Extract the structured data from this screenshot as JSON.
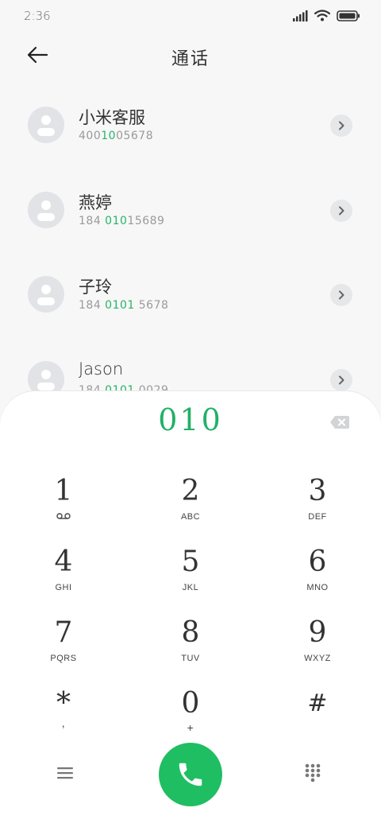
{
  "status_bar": {
    "time": "2:36"
  },
  "header": {
    "title": "通话"
  },
  "contacts": [
    {
      "name": "小米客服",
      "number_pre": "400",
      "number_match": "10",
      "number_post": "05678"
    },
    {
      "name": "燕婷",
      "number_pre": "184 ",
      "number_match": "010",
      "number_post": "15689"
    },
    {
      "name": "子玲",
      "number_pre": "184 ",
      "number_match": "0101",
      "number_post": " 5678"
    },
    {
      "name": "Jason",
      "number_pre": "184 ",
      "number_match": "0101",
      "number_post": " 0029"
    }
  ],
  "dialpad": {
    "dialed_number": "010",
    "keys": [
      {
        "digit": "1",
        "letters": "voicemail"
      },
      {
        "digit": "2",
        "letters": "ABC"
      },
      {
        "digit": "3",
        "letters": "DEF"
      },
      {
        "digit": "4",
        "letters": "GHI"
      },
      {
        "digit": "5",
        "letters": "JKL"
      },
      {
        "digit": "6",
        "letters": "MNO"
      },
      {
        "digit": "7",
        "letters": "PQRS"
      },
      {
        "digit": "8",
        "letters": "TUV"
      },
      {
        "digit": "9",
        "letters": "WXYZ"
      },
      {
        "digit": "*",
        "letters": ","
      },
      {
        "digit": "0",
        "letters": "+"
      },
      {
        "digit": "#",
        "letters": ""
      }
    ]
  },
  "colors": {
    "accent": "#28b46b",
    "call_button": "#1fbe63"
  },
  "icons": {
    "back": "arrow-left-icon",
    "backspace": "backspace-icon",
    "menu": "menu-icon",
    "call": "phone-icon",
    "keypad": "keypad-icon"
  }
}
